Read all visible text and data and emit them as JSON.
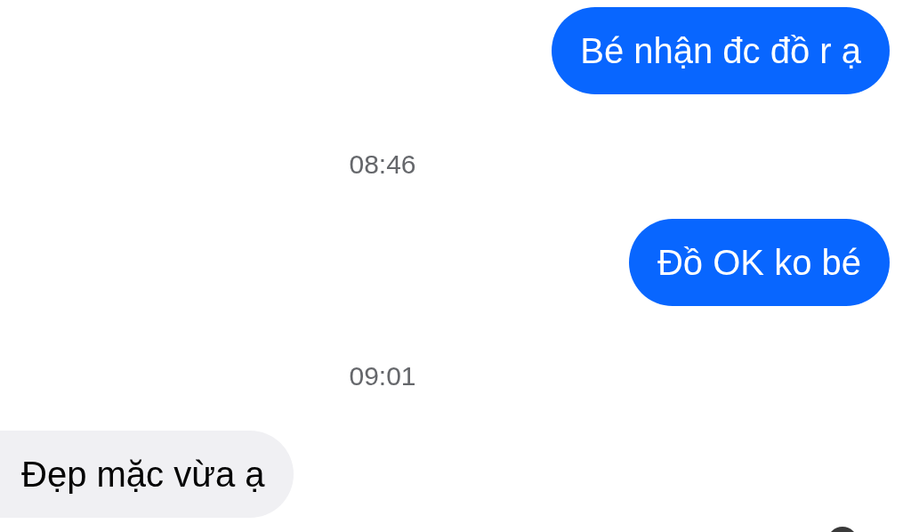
{
  "messages": [
    {
      "kind": "sent",
      "text": "Bé nhận đc đồ r ạ"
    },
    {
      "kind": "time",
      "text": "08:46"
    },
    {
      "kind": "sent",
      "text": "Đồ OK ko bé"
    },
    {
      "kind": "time",
      "text": "09:01"
    },
    {
      "kind": "received",
      "text": "Đẹp mặc vừa ạ"
    }
  ]
}
